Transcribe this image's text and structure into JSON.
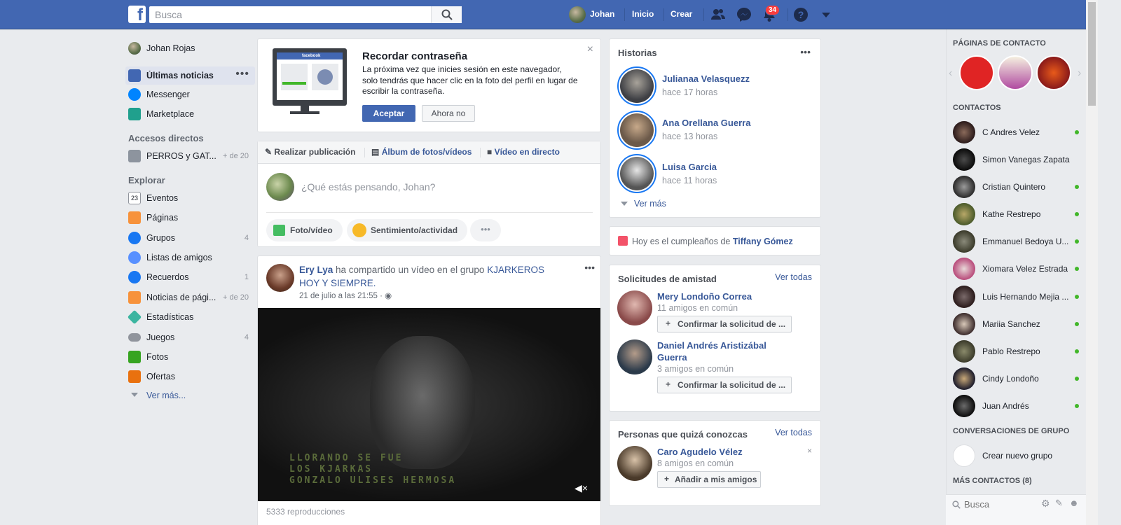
{
  "header": {
    "search_placeholder": "Busca",
    "user_name": "Johan",
    "home_label": "Inicio",
    "create_label": "Crear",
    "notification_count": "34",
    "brand_color": "#4267b2"
  },
  "left_nav": {
    "profile_name": "Johan Rojas",
    "main_items": [
      {
        "label": "Últimas noticias",
        "icon": "news-feed-icon"
      },
      {
        "label": "Messenger",
        "icon": "messenger-icon"
      },
      {
        "label": "Marketplace",
        "icon": "marketplace-icon"
      }
    ],
    "shortcuts_heading": "Accesos directos",
    "shortcuts": [
      {
        "label": "PERROS y GAT...",
        "count": "+ de 20"
      }
    ],
    "explore_heading": "Explorar",
    "explore_items": [
      {
        "label": "Eventos",
        "count": ""
      },
      {
        "label": "Páginas",
        "count": ""
      },
      {
        "label": "Grupos",
        "count": "4"
      },
      {
        "label": "Listas de amigos",
        "count": ""
      },
      {
        "label": "Recuerdos",
        "count": "1"
      },
      {
        "label": "Noticias de pági...",
        "count": "+ de 20"
      },
      {
        "label": "Estadísticas",
        "count": ""
      },
      {
        "label": "Juegos",
        "count": "4"
      },
      {
        "label": "Fotos",
        "count": ""
      },
      {
        "label": "Ofertas",
        "count": ""
      }
    ],
    "see_more": "Ver más..."
  },
  "password_card": {
    "title": "Recordar contraseña",
    "body": "La próxima vez que inicies sesión en este navegador, solo tendrás que hacer clic en la foto del perfil en lugar de escribir la contraseña.",
    "accept": "Aceptar",
    "decline": "Ahora no",
    "mini_brand": "facebook"
  },
  "composer": {
    "tab_post": "Realizar publicación",
    "tab_album": "Álbum de fotos/vídeos",
    "tab_live": "Vídeo en directo",
    "placeholder": "¿Qué estás pensando, Johan?",
    "photo_btn": "Foto/vídeo",
    "feeling_btn": "Sentimiento/actividad"
  },
  "post": {
    "author": "Ery Lya",
    "action": " ha compartido un vídeo en el grupo ",
    "group": "KJARKEROS HOY Y SIEMPRE.",
    "time": "21 de julio a las 21:55 · ",
    "video_caption_1": "LLORANDO SE FUE",
    "video_caption_2": "LOS KJARKAS",
    "video_caption_3": "GONZALO ULISES HERMOSA",
    "views": "5333 reproducciones"
  },
  "stories": {
    "title": "Historias",
    "items": [
      {
        "name": "Julianaa Velasquezz",
        "time": "hace 17 horas"
      },
      {
        "name": "Ana Orellana Guerra",
        "time": "hace 13 horas"
      },
      {
        "name": "Luisa Garcia",
        "time": "hace 11 horas"
      }
    ],
    "see_more": "Ver más"
  },
  "birthday": {
    "prefix": "Hoy es el cumpleaños de ",
    "name": "Tiffany Gómez"
  },
  "friend_requests": {
    "title": "Solicitudes de amistad",
    "see_all": "Ver todas",
    "items": [
      {
        "name": "Mery Londoño Correa",
        "mutual": "11 amigos en común",
        "button": "Confirmar la solicitud de ..."
      },
      {
        "name": "Daniel Andrés Aristizábal Guerra",
        "mutual": "3 amigos en común",
        "button": "Confirmar la solicitud de ..."
      }
    ]
  },
  "people_you_may_know": {
    "title": "Personas que quizá conozcas",
    "see_all": "Ver todas",
    "items": [
      {
        "name": "Caro Agudelo Vélez",
        "mutual": "8 amigos en común",
        "button": "Añadir a mis amigos"
      }
    ]
  },
  "right_sidebar": {
    "pages_heading": "PÁGINAS DE CONTACTO",
    "contacts_heading": "CONTACTOS",
    "contacts": [
      "C Andres Velez",
      "Simon Vanegas Zapata",
      "Cristian Quintero",
      "Kathe Restrepo",
      "Emmanuel Bedoya U...",
      "Xiomara Velez Estrada",
      "Luis Hernando Mejia ...",
      "Mariia Sanchez",
      "Pablo Restrepo",
      "Cindy Londoño",
      "Juan Andrés"
    ],
    "group_heading": "CONVERSACIONES DE GRUPO",
    "create_group": "Crear nuevo grupo",
    "more_contacts": "MÁS CONTACTOS (8)",
    "search_placeholder": "Busca"
  }
}
